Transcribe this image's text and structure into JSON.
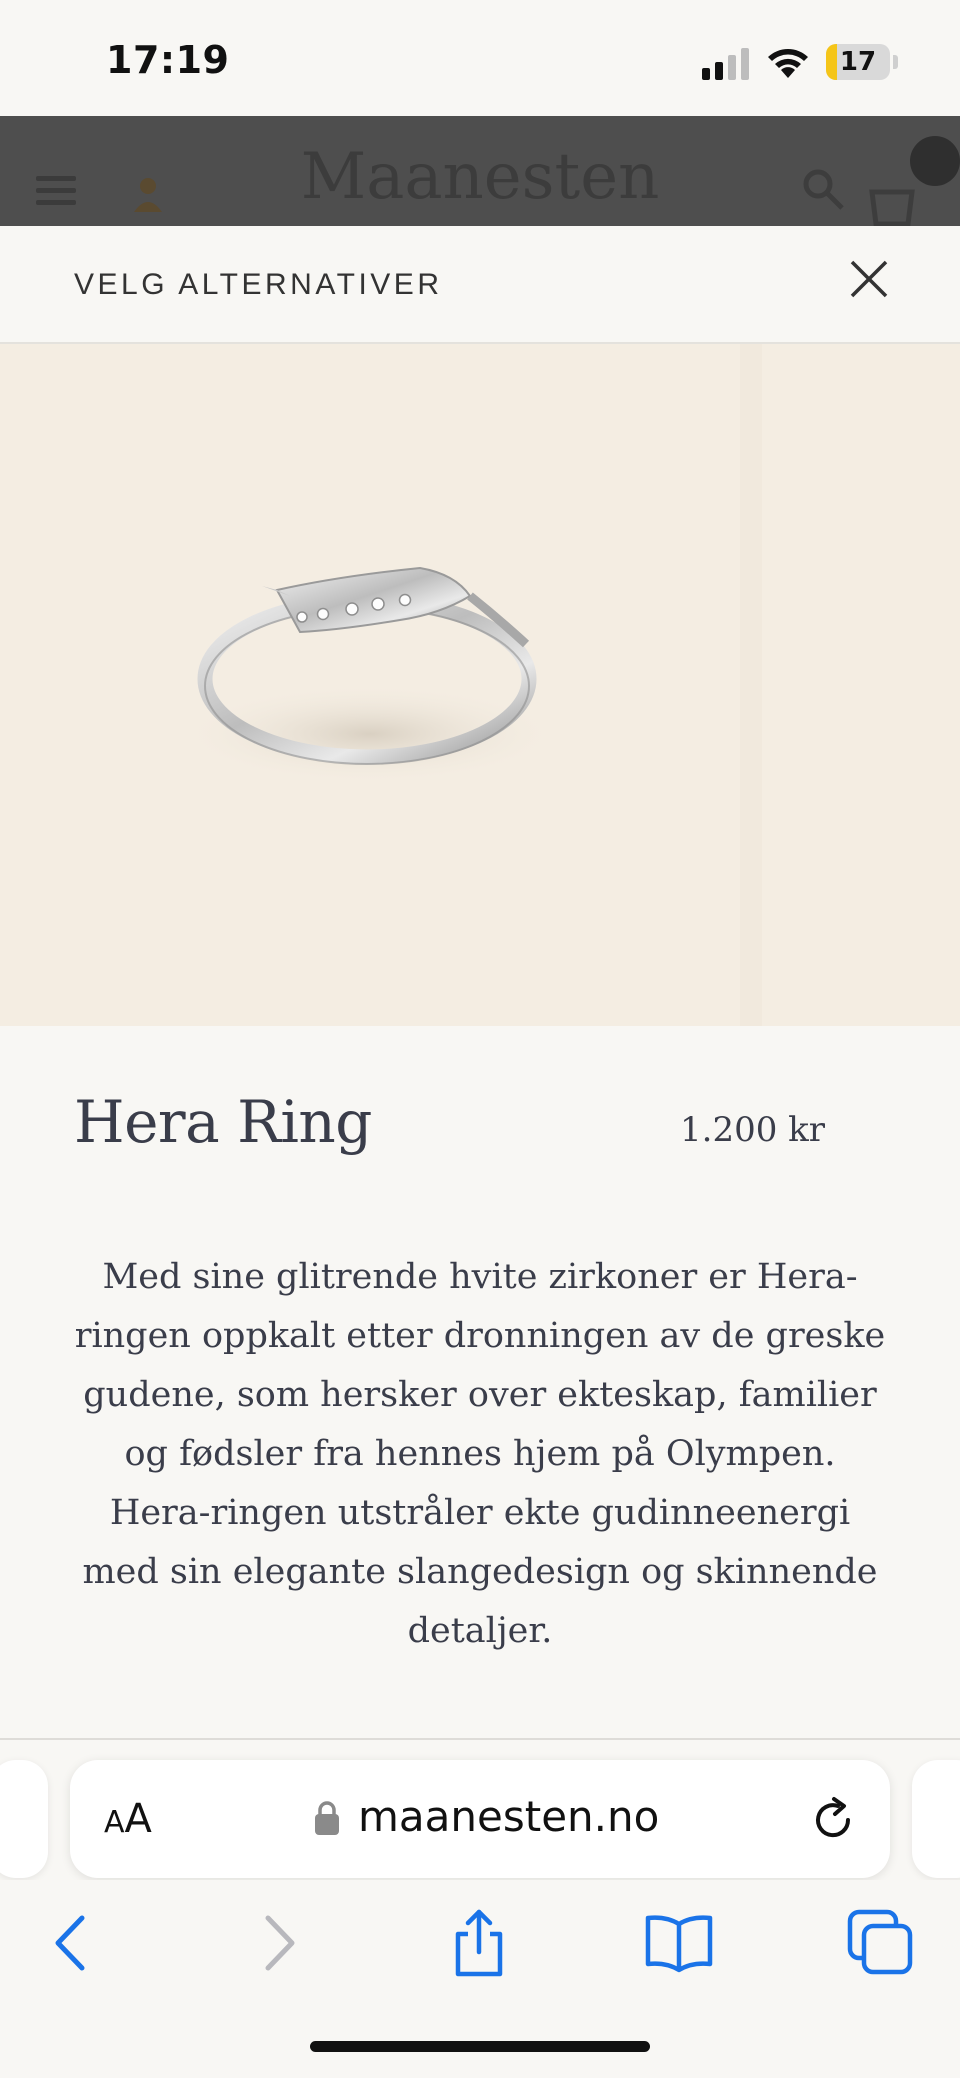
{
  "status_bar": {
    "time": "17:19",
    "battery": "17",
    "battery_level": 0.17
  },
  "site_header": {
    "logo": "Maanesten"
  },
  "sheet": {
    "title": "VELG ALTERNATIVER"
  },
  "product": {
    "name": "Hera Ring",
    "price": "1.200 kr",
    "description": "Med sine glitrende hvite zirkoner er Hera-ringen oppkalt etter dronningen av de greske gudene, som hersker over ekteskap, familier og fødsler fra hennes hjem på Olympen. Hera-ringen utstråler ekte gudinneenergi med sin elegante slangedesign og skinnende detaljer."
  },
  "browser": {
    "text_size_label_large": "A",
    "text_size_label_small": "A",
    "url": "maanesten.no"
  },
  "colors": {
    "accent": "#1a73e8",
    "text": "#3a3d4a",
    "image_bg": "#f4ede2"
  }
}
